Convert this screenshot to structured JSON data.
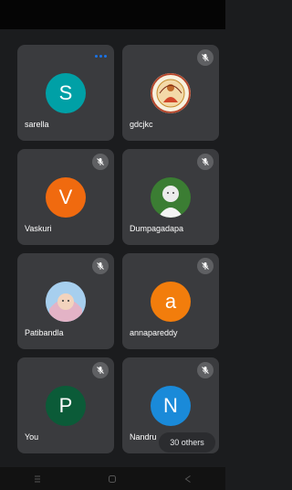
{
  "participants": [
    {
      "name": "sarella",
      "initial": "S",
      "color": "#00a0a6",
      "muted": false
    },
    {
      "name": "gdcjkc",
      "initial": "",
      "muted": true
    },
    {
      "name": "Vaskuri",
      "initial": "V",
      "color": "#f06a0f",
      "muted": true
    },
    {
      "name": "Dumpagadapa",
      "initial": "",
      "muted": true
    },
    {
      "name": "Patibandla",
      "initial": "",
      "muted": true
    },
    {
      "name": "annapareddy",
      "initial": "a",
      "color": "#f27d0c",
      "muted": true
    },
    {
      "name": "You",
      "initial": "P",
      "color": "#0b5b38",
      "muted": true
    },
    {
      "name": "Nandru",
      "initial": "N",
      "color": "#1a8ad9",
      "muted": true
    }
  ],
  "others_chip": "30 others",
  "icons": {
    "mic_off": "mic-off-icon",
    "more": "more-options-icon",
    "nav_menu": "recent-apps-icon",
    "nav_home": "home-icon",
    "nav_back": "back-icon"
  }
}
